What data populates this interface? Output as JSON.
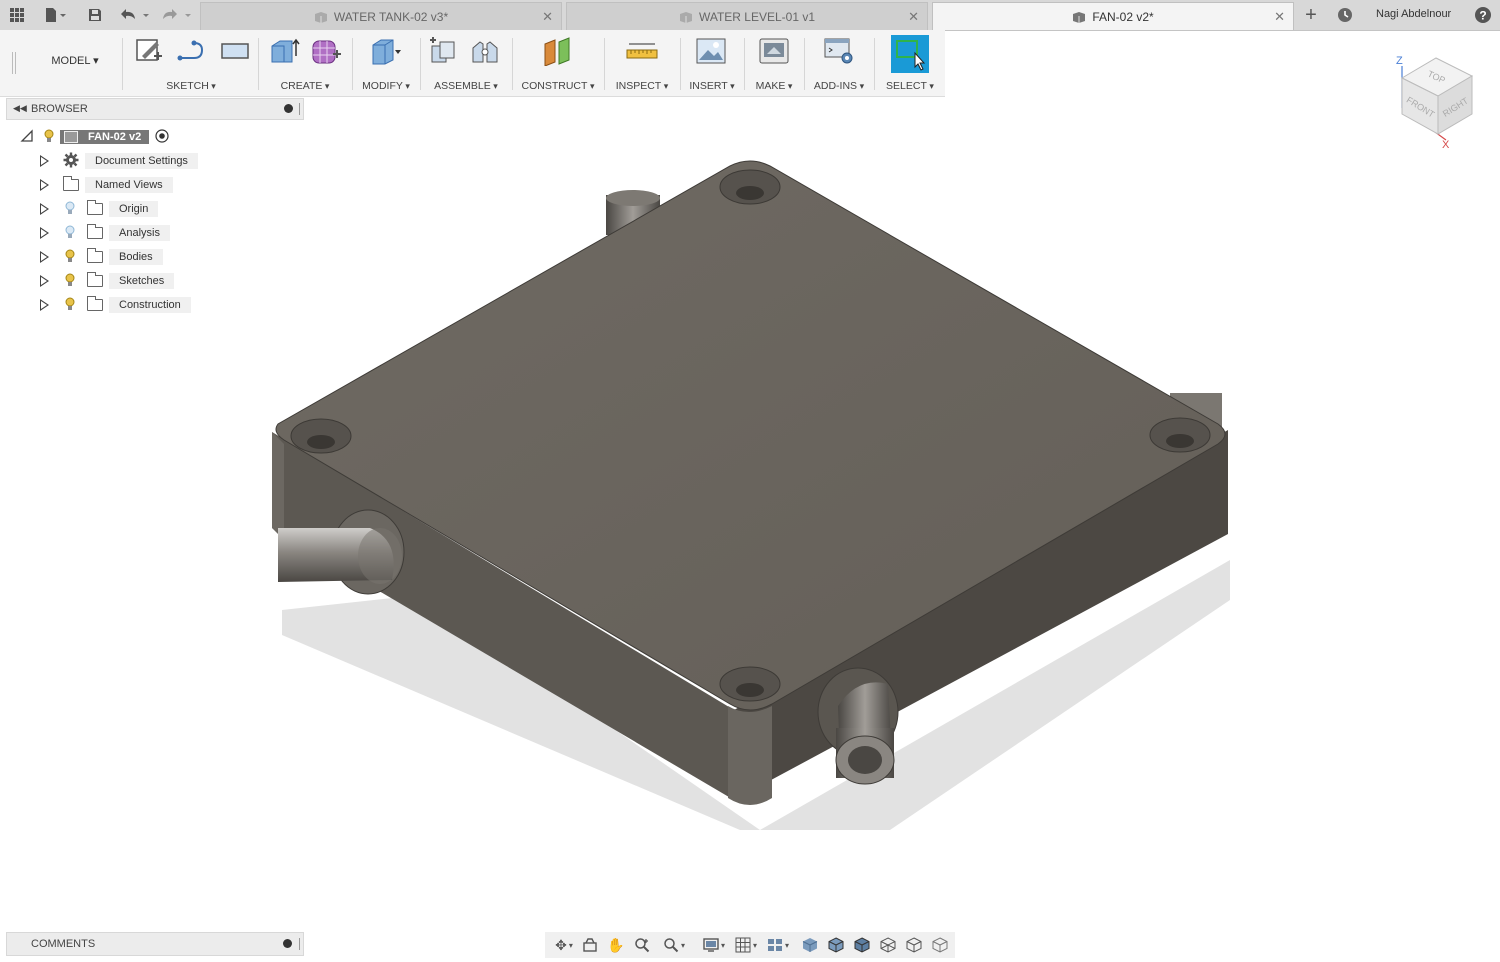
{
  "tabs": [
    {
      "label": "WATER TANK-02 v3*",
      "active": false
    },
    {
      "label": "WATER LEVEL-01 v1",
      "active": false
    },
    {
      "label": "FAN-02 v2*",
      "active": true
    }
  ],
  "user": {
    "name": "Nagi Abdelnour"
  },
  "workspace": {
    "label": "MODEL"
  },
  "toolbar": {
    "groups": [
      "SKETCH",
      "CREATE",
      "MODIFY",
      "ASSEMBLE",
      "CONSTRUCT",
      "INSPECT",
      "INSERT",
      "MAKE",
      "ADD-INS",
      "SELECT"
    ]
  },
  "browser": {
    "title": "BROWSER",
    "root": {
      "label": "FAN-02 v2"
    },
    "items": [
      {
        "label": "Document Settings",
        "icon": "gear-icon"
      },
      {
        "label": "Named Views",
        "icon": "folder-icon"
      },
      {
        "label": "Origin",
        "icon": "folder-icon",
        "bulb": "off"
      },
      {
        "label": "Analysis",
        "icon": "folder-icon",
        "bulb": "off"
      },
      {
        "label": "Bodies",
        "icon": "folder-icon",
        "bulb": "on"
      },
      {
        "label": "Sketches",
        "icon": "folder-icon",
        "bulb": "on"
      },
      {
        "label": "Construction",
        "icon": "folder-icon",
        "bulb": "on"
      }
    ]
  },
  "viewcube": {
    "top": "TOP",
    "front": "FRONT",
    "right": "RIGHT",
    "axis_z": "Z",
    "axis_x": "X"
  },
  "comments": {
    "title": "COMMENTS"
  },
  "colors": {
    "body": "#6b665f",
    "select_accent": "#1a9ad6",
    "bulb_on": "#e8c34a",
    "bulb_off": "#8fb7d6"
  }
}
